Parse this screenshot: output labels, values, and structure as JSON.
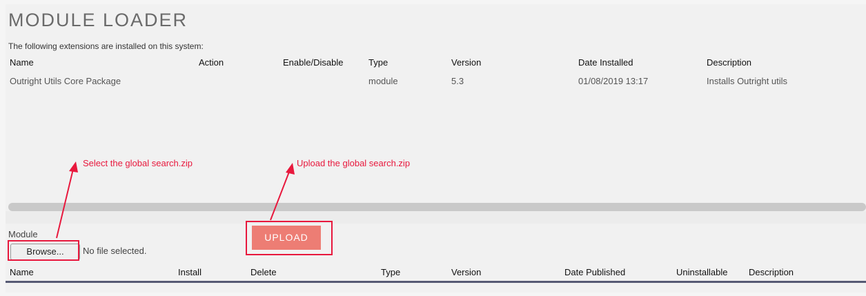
{
  "page": {
    "title": "MODULE LOADER",
    "subtitle": "The following extensions are installed on this system:"
  },
  "installed_table": {
    "headers": [
      "Name",
      "Action",
      "Enable/Disable",
      "Type",
      "Version",
      "Date Installed",
      "Description"
    ],
    "rows": [
      [
        "Outright Utils Core Package",
        "",
        "",
        "module",
        "5.3",
        "01/08/2019 13:17",
        "Installs Outright utils"
      ]
    ]
  },
  "annotations": {
    "select": "Select the global search.zip",
    "upload": "Upload the global search.zip",
    "color": "#e8183d"
  },
  "upload_form": {
    "module_label": "Module",
    "browse_label": "Browse...",
    "no_file_label": "No file selected.",
    "upload_label": "UPLOAD",
    "upload_color": "#ed7d74"
  },
  "available_table": {
    "headers": [
      "Name",
      "Install",
      "Delete",
      "Type",
      "Version",
      "Date Published",
      "Uninstallable",
      "Description"
    ]
  }
}
